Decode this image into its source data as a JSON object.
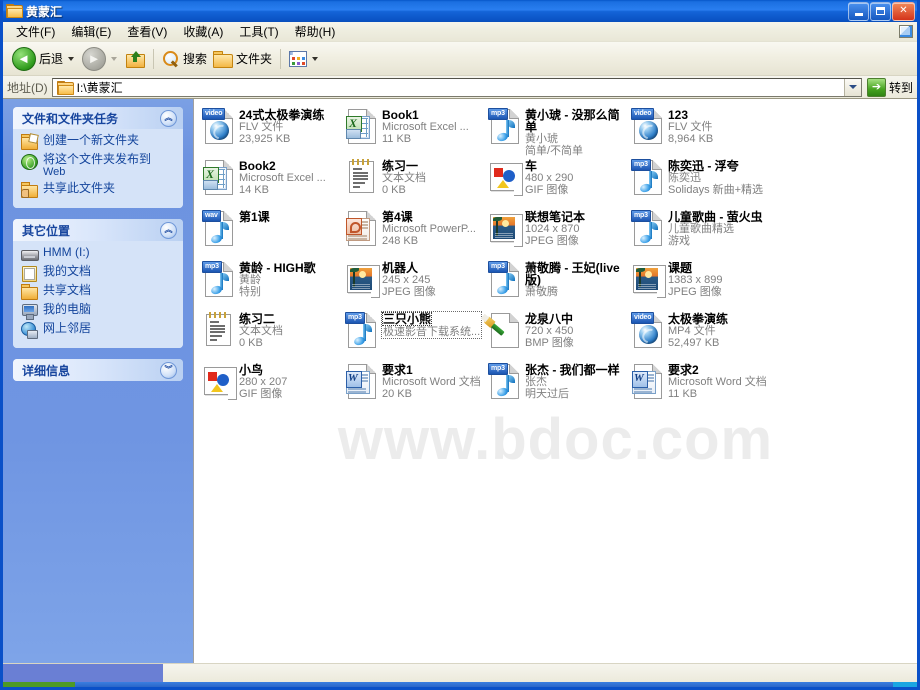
{
  "window": {
    "title": "黄蒙汇",
    "title_icon": "folder-icon",
    "minimize_label": "最小化",
    "maximize_label": "最大化",
    "close_label": "关闭"
  },
  "menu": {
    "items": [
      {
        "label": "文件(F)"
      },
      {
        "label": "编辑(E)"
      },
      {
        "label": "查看(V)"
      },
      {
        "label": "收藏(A)"
      },
      {
        "label": "工具(T)"
      },
      {
        "label": "帮助(H)"
      }
    ]
  },
  "toolbar": {
    "back_label": "后退",
    "forward_label": "",
    "up_label": "",
    "search_label": "搜索",
    "folders_label": "文件夹",
    "views_label": ""
  },
  "address": {
    "label": "地址(D)",
    "value": "I:\\黄蒙汇",
    "go_label": "转到"
  },
  "sidebar": {
    "panels": [
      {
        "title": "文件和文件夹任务",
        "collapse_glyph": "︽",
        "items": [
          {
            "label": "创建一个新文件夹",
            "sub": "",
            "icon": "new-folder-icon"
          },
          {
            "label": "将这个文件夹发布到",
            "sub": "Web",
            "icon": "publish-web-icon"
          },
          {
            "label": "共享此文件夹",
            "sub": "",
            "icon": "share-folder-icon"
          }
        ]
      },
      {
        "title": "其它位置",
        "collapse_glyph": "︽",
        "items": [
          {
            "label": "HMM (I:)",
            "sub": "",
            "icon": "drive-icon"
          },
          {
            "label": "我的文档",
            "sub": "",
            "icon": "my-documents-icon"
          },
          {
            "label": "共享文档",
            "sub": "",
            "icon": "shared-documents-icon"
          },
          {
            "label": "我的电脑",
            "sub": "",
            "icon": "my-computer-icon"
          },
          {
            "label": "网上邻居",
            "sub": "",
            "icon": "network-icon"
          }
        ]
      },
      {
        "title": "详细信息",
        "collapse_glyph": "︾",
        "items": []
      }
    ]
  },
  "filepane": {
    "watermark": "www.bdoc.com",
    "files": [
      {
        "name": "24式太极拳演练",
        "line2": "FLV 文件",
        "line3": "23,925 KB",
        "icon": "video-file-icon",
        "badge": "video",
        "selected": false
      },
      {
        "name": "Book1",
        "line2": "Microsoft Excel ...",
        "line3": "11 KB",
        "icon": "excel-file-icon",
        "badge": "",
        "selected": false
      },
      {
        "name": "黄小琥 - 没那么简单",
        "line2": "黄小琥",
        "line3": "简单/不简单",
        "icon": "mp3-file-icon",
        "badge": "mp3",
        "selected": false
      },
      {
        "name": "123",
        "line2": "FLV 文件",
        "line3": "8,964 KB",
        "icon": "video-file-icon",
        "badge": "video",
        "selected": false
      },
      {
        "name": "",
        "line2": "",
        "line3": "",
        "icon": "",
        "badge": "",
        "selected": false
      },
      {
        "name": "Book2",
        "line2": "Microsoft Excel ...",
        "line3": "14 KB",
        "icon": "excel-file-icon",
        "badge": "",
        "selected": false
      },
      {
        "name": "练习一",
        "line2": "文本文档",
        "line3": "0 KB",
        "icon": "text-file-icon",
        "badge": "",
        "selected": false
      },
      {
        "name": "车",
        "line2": "480 x 290",
        "line3": "GIF 图像",
        "icon": "gif-image-icon",
        "badge": "",
        "selected": false
      },
      {
        "name": "陈奕迅 - 浮夸",
        "line2": "陈奕迅",
        "line3": "Solidays 新曲+精选",
        "icon": "mp3-file-icon",
        "badge": "mp3",
        "selected": false
      },
      {
        "name": "",
        "line2": "",
        "line3": "",
        "icon": "",
        "badge": "",
        "selected": false
      },
      {
        "name": "第1课",
        "line2": "",
        "line3": "",
        "icon": "wav-file-icon",
        "badge": "wav",
        "selected": false
      },
      {
        "name": "第4课",
        "line2": "Microsoft PowerP...",
        "line3": "248 KB",
        "icon": "powerpoint-file-icon",
        "badge": "",
        "selected": false
      },
      {
        "name": "联想笔记本",
        "line2": "1024 x 870",
        "line3": "JPEG 图像",
        "icon": "jpeg-image-icon",
        "badge": "",
        "selected": false
      },
      {
        "name": "儿童歌曲 - 萤火虫",
        "line2": "儿童歌曲精选",
        "line3": "游戏",
        "icon": "mp3-file-icon",
        "badge": "mp3",
        "selected": false
      },
      {
        "name": "",
        "line2": "",
        "line3": "",
        "icon": "",
        "badge": "",
        "selected": false
      },
      {
        "name": "黄龄 - HIGH歌",
        "line2": "黄龄",
        "line3": "特别",
        "icon": "mp3-file-icon",
        "badge": "mp3",
        "selected": false
      },
      {
        "name": "机器人",
        "line2": "245 x 245",
        "line3": "JPEG 图像",
        "icon": "jpeg-image-icon",
        "badge": "",
        "selected": false
      },
      {
        "name": "萧敬腾 - 王妃(live版)",
        "line2": "萧敬腾",
        "line3": "",
        "icon": "mp3-file-icon",
        "badge": "mp3",
        "selected": false
      },
      {
        "name": "课题",
        "line2": "1383 x 899",
        "line3": "JPEG 图像",
        "icon": "jpeg-image-icon",
        "badge": "",
        "selected": false
      },
      {
        "name": "",
        "line2": "",
        "line3": "",
        "icon": "",
        "badge": "",
        "selected": false
      },
      {
        "name": "练习二",
        "line2": "文本文档",
        "line3": "0 KB",
        "icon": "text-file-icon",
        "badge": "",
        "selected": false
      },
      {
        "name": "三只小熊",
        "line2": "极速影音下载系统...",
        "line3": "",
        "icon": "mp3-file-icon",
        "badge": "mp3",
        "selected": true
      },
      {
        "name": "龙泉八中",
        "line2": "720 x 450",
        "line3": "BMP 图像",
        "icon": "bmp-image-icon",
        "badge": "",
        "selected": false
      },
      {
        "name": "太极拳演练",
        "line2": "MP4 文件",
        "line3": "52,497 KB",
        "icon": "video-file-icon",
        "badge": "video",
        "selected": false
      },
      {
        "name": "",
        "line2": "",
        "line3": "",
        "icon": "",
        "badge": "",
        "selected": false
      },
      {
        "name": "小鸟",
        "line2": "280 x 207",
        "line3": "GIF 图像",
        "icon": "gif-image-icon",
        "badge": "",
        "selected": false
      },
      {
        "name": "要求1",
        "line2": "Microsoft Word 文档",
        "line3": "20 KB",
        "icon": "word-file-icon",
        "badge": "",
        "selected": false
      },
      {
        "name": "张杰 - 我们都一样",
        "line2": "张杰",
        "line3": "明天过后",
        "icon": "mp3-file-icon",
        "badge": "mp3",
        "selected": false
      },
      {
        "name": "要求2",
        "line2": "Microsoft Word 文档",
        "line3": "11 KB",
        "icon": "word-file-icon",
        "badge": "",
        "selected": false
      },
      {
        "name": "",
        "line2": "",
        "line3": "",
        "icon": "",
        "badge": "",
        "selected": false
      }
    ]
  },
  "statusbar": {
    "text": ""
  },
  "colors": {
    "titlebar_blue": "#1a6fe0",
    "sidebar_blue": "#6f95e2",
    "panel_body": "#d5e3f8",
    "link_blue": "#14459c",
    "meta_gray": "#808080"
  }
}
